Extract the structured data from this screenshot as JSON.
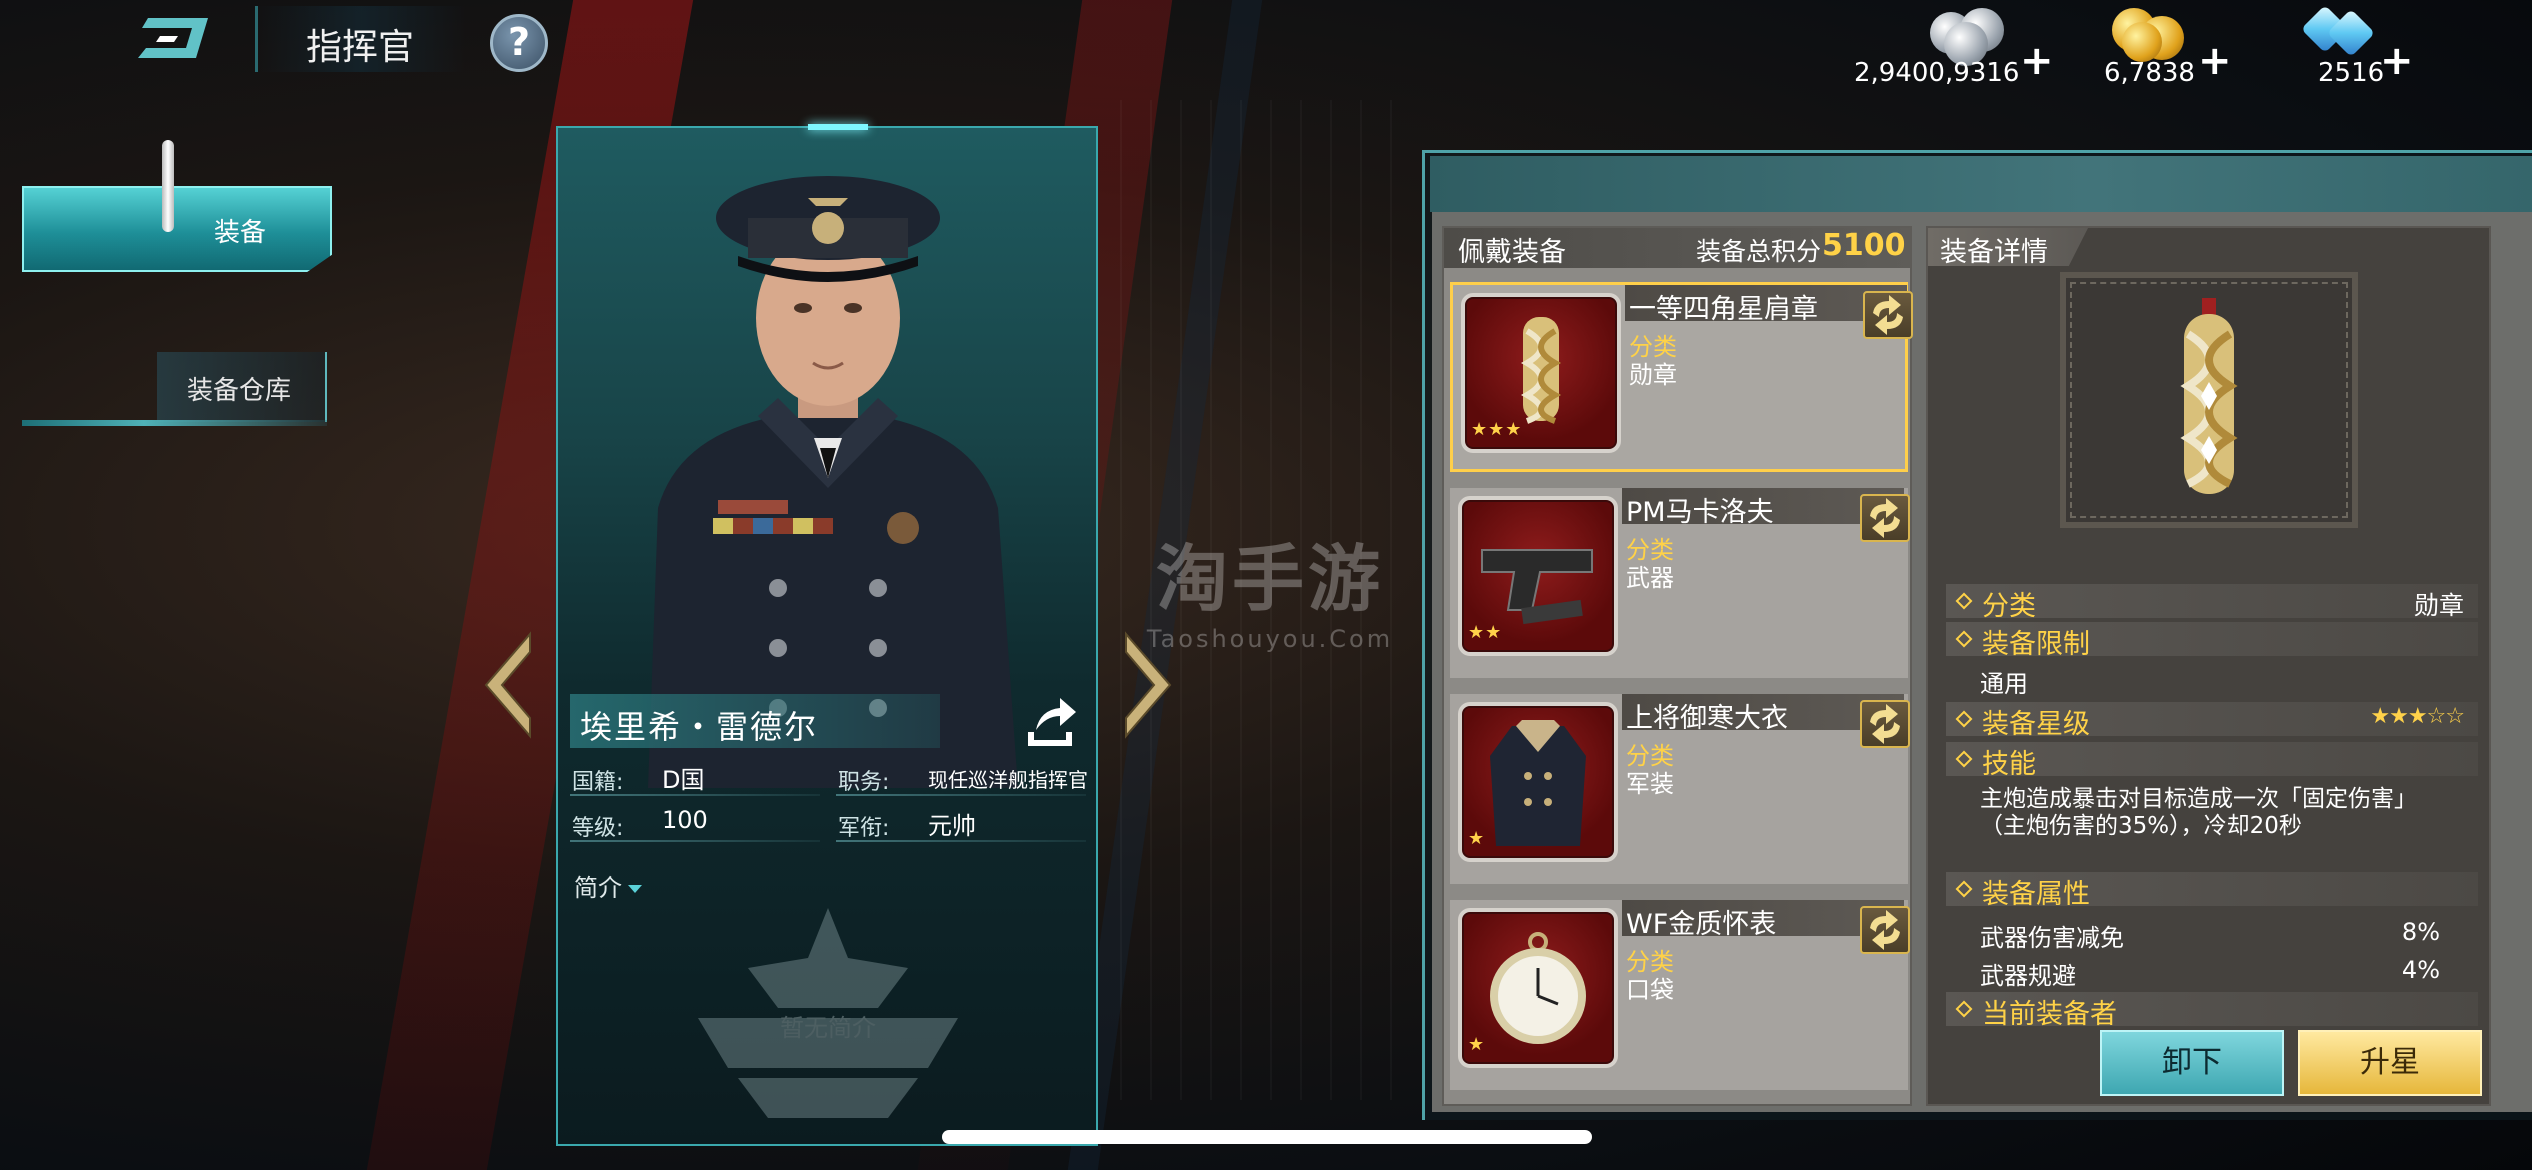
{
  "header": {
    "title": "指挥官",
    "help_label": "?"
  },
  "currency": {
    "silver": "2,9400,9316",
    "gold": "6,7838",
    "gems": "2516",
    "plus_label": "+"
  },
  "tabs": {
    "equip": "装备",
    "warehouse": "装备仓库"
  },
  "commander": {
    "name": "埃里希・雷德尔",
    "nationality_label": "国籍:",
    "nationality": "D国",
    "position_label": "职务:",
    "position": "现任巡洋舰指挥官",
    "level_label": "等级:",
    "level": "100",
    "rank_label": "军衔:",
    "rank": "元帅",
    "brief_label": "简介",
    "no_brief": "暂无简介"
  },
  "watermark": {
    "line1": "淘手游",
    "line2": "Taoshouyou.Com"
  },
  "worn": {
    "title": "佩戴装备",
    "score_label": "装备总积分",
    "score": "5100",
    "items": [
      {
        "name": "一等四角星肩章",
        "category_label": "分类",
        "category": "勋章",
        "stars": "★★★",
        "icon": "epaulette-icon"
      },
      {
        "name": "PM马卡洛夫",
        "category_label": "分类",
        "category": "武器",
        "stars": "★★",
        "icon": "pistol-icon"
      },
      {
        "name": "上将御寒大衣",
        "category_label": "分类",
        "category": "军装",
        "stars": "★",
        "icon": "coat-icon"
      },
      {
        "name": "WF金质怀表",
        "category_label": "分类",
        "category": "口袋",
        "stars": "★",
        "icon": "pocket-watch-icon"
      }
    ]
  },
  "detail": {
    "title": "装备详情",
    "category_key": "分类",
    "category_val": "勋章",
    "limit_key": "装备限制",
    "limit_val": "通用",
    "star_key": "装备星级",
    "star_val": "★★★☆☆",
    "skill_key": "技能",
    "skill_text": "主炮造成暴击对目标造成一次「固定伤害」（主炮伤害的35%），冷却20秒",
    "attr_key": "装备属性",
    "attrs": [
      {
        "name": "武器伤害减免",
        "value": "8%"
      },
      {
        "name": "武器规避",
        "value": "4%"
      }
    ],
    "owner_key": "当前装备者"
  },
  "buttons": {
    "unequip": "卸下",
    "upstar": "升星"
  },
  "colors": {
    "accent_teal": "#3ea7b1",
    "gold_text": "#ffd247",
    "card_red": "#8f1c1c"
  }
}
